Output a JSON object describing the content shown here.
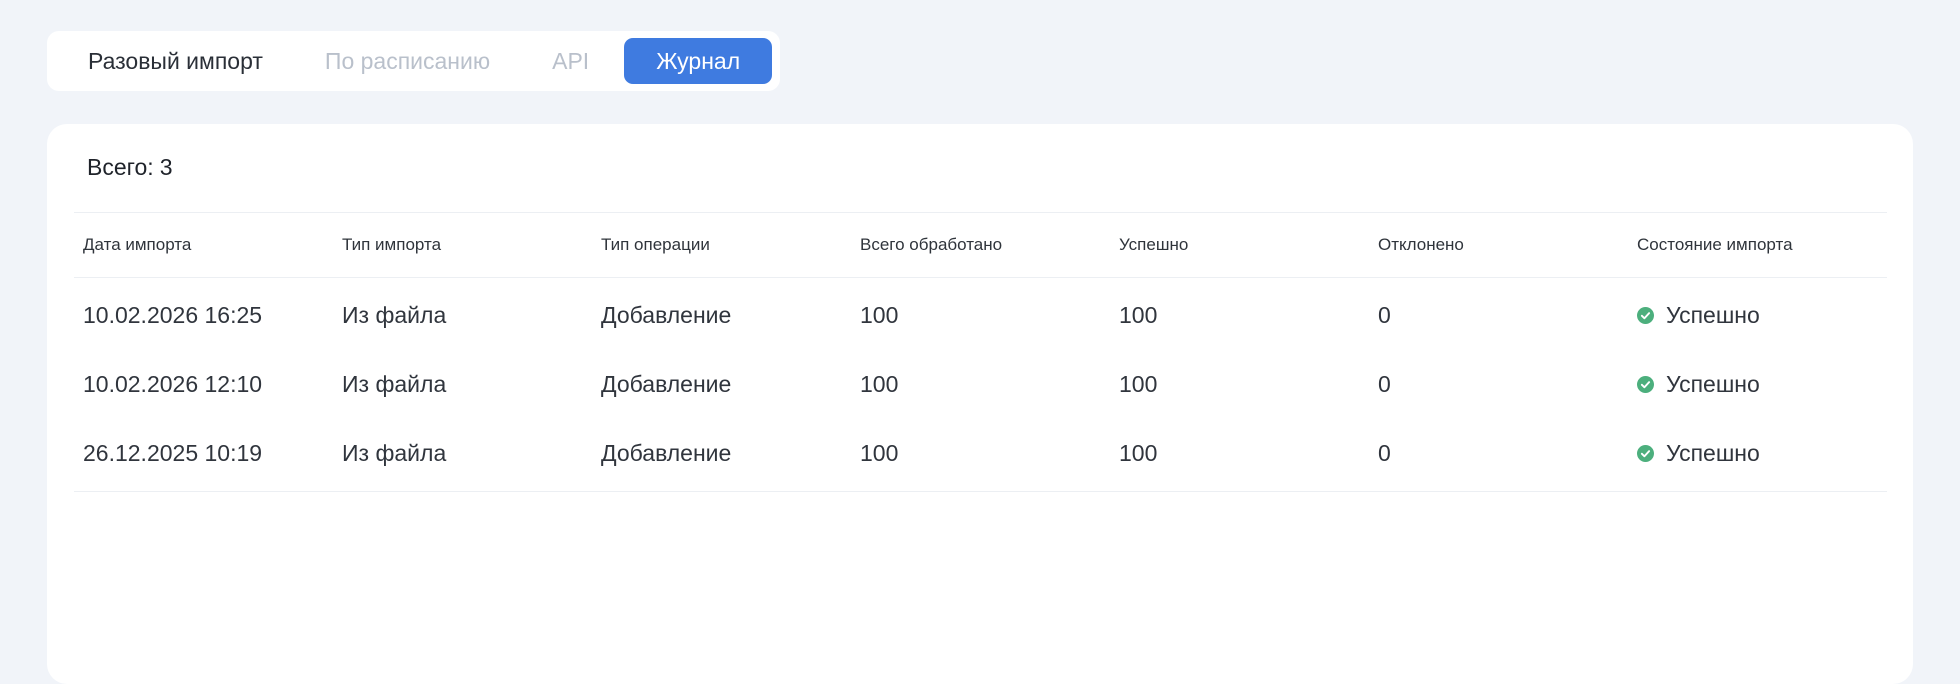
{
  "tabs": [
    {
      "label": "Разовый импорт",
      "state": "dark"
    },
    {
      "label": "По расписанию",
      "state": "muted"
    },
    {
      "label": "API",
      "state": "muted"
    },
    {
      "label": "Журнал",
      "state": "active"
    }
  ],
  "summary": {
    "total_label": "Всего:",
    "total_value": "3"
  },
  "table": {
    "columns": [
      "Дата импорта",
      "Тип импорта",
      "Тип операции",
      "Всего обработано",
      "Успешно",
      "Отклонено",
      "Состояние импорта"
    ],
    "rows": [
      {
        "date": "10.02.2026 16:25",
        "import_type": "Из файла",
        "operation": "Добавление",
        "processed": "100",
        "success": "100",
        "rejected": "0",
        "status": "Успешно"
      },
      {
        "date": "10.02.2026 12:10",
        "import_type": "Из файла",
        "operation": "Добавление",
        "processed": "100",
        "success": "100",
        "rejected": "0",
        "status": "Успешно"
      },
      {
        "date": "26.12.2025 10:19",
        "import_type": "Из файла",
        "operation": "Добавление",
        "processed": "100",
        "success": "100",
        "rejected": "0",
        "status": "Успешно"
      }
    ]
  },
  "colors": {
    "accent": "#3f7be0",
    "success": "#4caf7d",
    "background": "#f1f4f9"
  },
  "icons": {
    "status": "check-circle-icon"
  }
}
